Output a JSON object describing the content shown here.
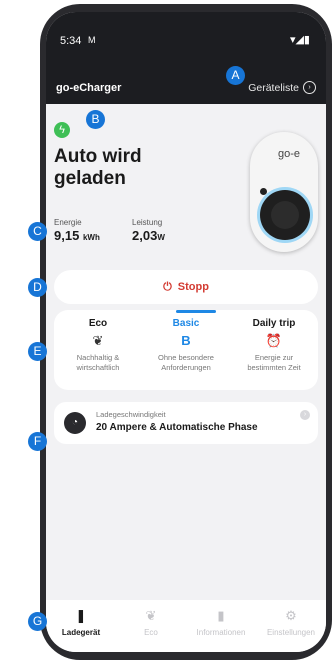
{
  "status_bar": {
    "time": "5:34",
    "notification_icon": "gmail-icon",
    "right_icons": "▾◢▮"
  },
  "app_bar": {
    "title": "go-eCharger",
    "device_list_label": "Geräteliste",
    "device_list_icon": "arrow-circle-icon"
  },
  "charging": {
    "status_icon": "lightning-bolt-icon",
    "status_title": "Auto wird\ngeladen",
    "energy": {
      "label": "Energie",
      "value": "9,15",
      "unit": "kWh"
    },
    "power": {
      "label": "Leistung",
      "value": "2,03",
      "unit": "W"
    }
  },
  "charger": {
    "logo": "go-e"
  },
  "stop_button": {
    "label": "Stopp",
    "icon": "power-icon"
  },
  "modes": [
    {
      "name": "Eco",
      "icon": "leaf-icon",
      "glyph": "❦",
      "description": "Nachhaltig &\nwirtschaftlich",
      "active": false
    },
    {
      "name": "Basic",
      "icon": "basic-b-icon",
      "glyph": "B",
      "description": "Ohne besondere\nAnforderungen",
      "active": true
    },
    {
      "name": "Daily trip",
      "icon": "alarm-clock-icon",
      "glyph": "⏰",
      "description": "Energie zur\nbestimmten Zeit",
      "active": false
    }
  ],
  "speed": {
    "label": "Ladegeschwindigkeit",
    "value": "20 Ampere & Automatische Phase",
    "icon": "speedometer-icon"
  },
  "nav": [
    {
      "label": "Ladegerät",
      "icon": "charger-icon",
      "glyph": "❚",
      "active": true
    },
    {
      "label": "Eco",
      "icon": "leaf-icon",
      "glyph": "❦",
      "active": false
    },
    {
      "label": "Informationen",
      "icon": "bar-chart-icon",
      "glyph": "▮",
      "active": false
    },
    {
      "label": "Einstellungen",
      "icon": "gear-icon",
      "glyph": "⚙",
      "active": false
    }
  ],
  "callouts": [
    "A",
    "B",
    "C",
    "D",
    "E",
    "F",
    "G"
  ],
  "colors": {
    "accent": "#1e88e5",
    "callout": "#1775d6",
    "stop": "#d33b32",
    "bolt": "#3fbf56",
    "header": "#1c1d21"
  }
}
